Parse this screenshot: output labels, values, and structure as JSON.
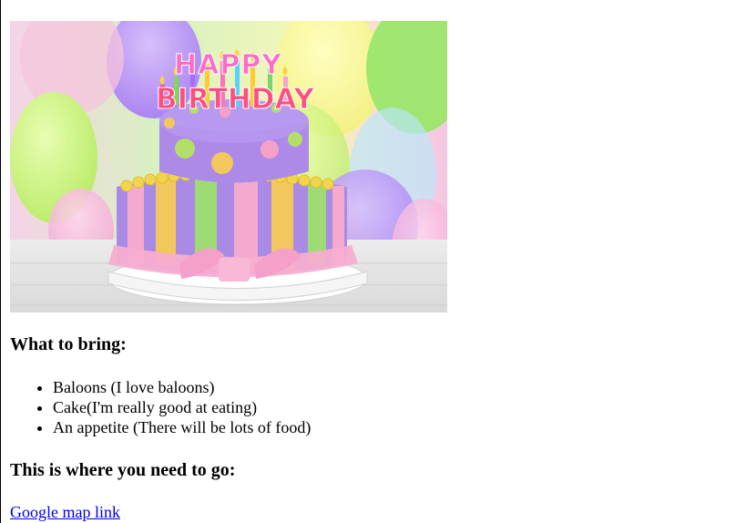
{
  "image": {
    "cake_text_line1": "HAPPY",
    "cake_text_line2": "BIRTHDAY"
  },
  "sections": {
    "bring_heading": "What to bring:",
    "bring_items": [
      "Baloons (I love baloons)",
      "Cake(I'm really good at eating)",
      "An appetite (There will be lots of food)"
    ],
    "go_heading": "This is where you need to go:",
    "map_link_text": "Google map link"
  }
}
